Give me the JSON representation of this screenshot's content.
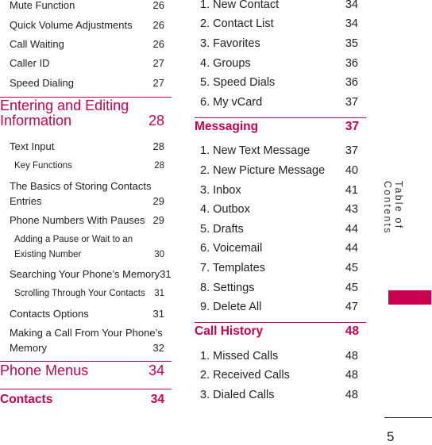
{
  "accent_color": "#c8004f",
  "left_column": [
    {
      "type": "item",
      "label": "Mute Function",
      "page": "26"
    },
    {
      "type": "item",
      "label": "Quick Volume Adjustments",
      "page": "26"
    },
    {
      "type": "item",
      "label": "Call Waiting",
      "page": "26"
    },
    {
      "type": "item",
      "label": "Caller ID",
      "page": "27"
    },
    {
      "type": "item",
      "label": "Speed Dialing",
      "page": "27"
    },
    {
      "type": "head",
      "label": "Entering and Editing",
      "page": ""
    },
    {
      "type": "head",
      "label": "Information",
      "page": "28"
    },
    {
      "type": "item",
      "label": "Text Input",
      "page": "28"
    },
    {
      "type": "sub",
      "label": "Key Functions",
      "page": "28"
    },
    {
      "type": "item",
      "label": "The Basics of Storing Contacts",
      "page": ""
    },
    {
      "type": "item",
      "label": "Entries",
      "page": "29"
    },
    {
      "type": "item",
      "label": "Phone Numbers With Pauses",
      "page": "29"
    },
    {
      "type": "sub",
      "label": "Adding a Pause or Wait to an",
      "page": ""
    },
    {
      "type": "sub",
      "label": "Existing Number",
      "page": "30"
    },
    {
      "type": "item",
      "label": "Searching Your Phone’s Memory",
      "page": "31"
    },
    {
      "type": "sub",
      "label": "Scrolling Through Your Contacts",
      "page": "31"
    },
    {
      "type": "item",
      "label": "Contacts Options",
      "page": "31"
    },
    {
      "type": "item",
      "label": "Making a Call From Your Phone’s",
      "page": ""
    },
    {
      "type": "item",
      "label": "Memory",
      "page": "32"
    },
    {
      "type": "head",
      "label": "Phone Menus",
      "page": "34"
    },
    {
      "type": "bhead",
      "label": "Contacts",
      "page": "34"
    }
  ],
  "right_column": [
    {
      "type": "num",
      "label": "1. New Contact",
      "page": "34"
    },
    {
      "type": "num",
      "label": "2. Contact List",
      "page": "34"
    },
    {
      "type": "num",
      "label": "3. Favorites",
      "page": "35"
    },
    {
      "type": "num",
      "label": "4. Groups",
      "page": "36"
    },
    {
      "type": "num",
      "label": "5. Speed Dials",
      "page": "36"
    },
    {
      "type": "num",
      "label": "6. My vCard",
      "page": "37"
    },
    {
      "type": "bhead",
      "label": "Messaging",
      "page": "37"
    },
    {
      "type": "num",
      "label": "1. New Text Message",
      "page": "37"
    },
    {
      "type": "num",
      "label": "2. New Picture Message",
      "page": "40"
    },
    {
      "type": "num",
      "label": "3. Inbox",
      "page": "41"
    },
    {
      "type": "num",
      "label": "4. Outbox",
      "page": "43"
    },
    {
      "type": "num",
      "label": "5. Drafts",
      "page": "44"
    },
    {
      "type": "num",
      "label": "6. Voicemail",
      "page": "44"
    },
    {
      "type": "num",
      "label": "7. Templates",
      "page": "45"
    },
    {
      "type": "num",
      "label": "8. Settings",
      "page": "45"
    },
    {
      "type": "num",
      "label": "9. Delete All",
      "page": "47"
    },
    {
      "type": "bhead",
      "label": "Call History",
      "page": "48"
    },
    {
      "type": "num",
      "label": "1. Missed Calls",
      "page": "48"
    },
    {
      "type": "num",
      "label": "2. Received Calls",
      "page": "48"
    },
    {
      "type": "num",
      "label": "3. Dialed Calls",
      "page": "48"
    }
  ],
  "side_tab": "Table of Contents",
  "page_number": "5"
}
